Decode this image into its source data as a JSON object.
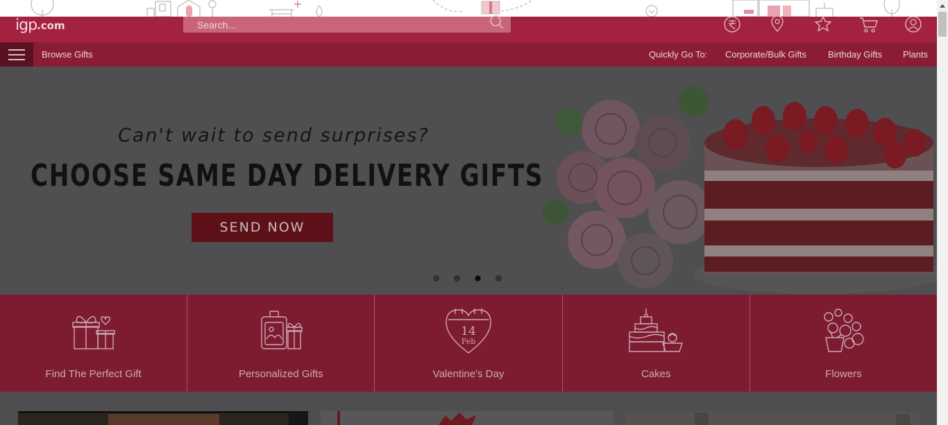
{
  "header": {
    "logo_main": "igp",
    "logo_suffix": ".com",
    "search_placeholder": "Search..."
  },
  "header_icons": [
    "currency-icon",
    "location-pin-icon",
    "star-icon",
    "cart-icon",
    "account-icon"
  ],
  "navbar": {
    "browse_label": "Browse Gifts",
    "quick_label": "Quickly Go To:",
    "links": [
      "Corporate/Bulk Gifts",
      "Birthday Gifts",
      "Plants"
    ]
  },
  "banner": {
    "tagline": "Can't wait to send surprises?",
    "headline": "CHOOSE SAME DAY DELIVERY GIFTS",
    "cta_label": "SEND NOW",
    "slide_count": 4,
    "active_slide": 3
  },
  "categories": [
    {
      "label": "Find The Perfect Gift",
      "icon": "gift-boxes-icon"
    },
    {
      "label": "Personalized Gifts",
      "icon": "personalized-gift-icon"
    },
    {
      "label": "Valentine's Day",
      "icon": "valentine-calendar-icon",
      "icon_day": "14",
      "icon_month": "Feb"
    },
    {
      "label": "Cakes",
      "icon": "cake-icon"
    },
    {
      "label": "Flowers",
      "icon": "flowers-icon"
    }
  ],
  "colors": {
    "header_bg": "#a3223f",
    "navbar_bg": "#8a1c33",
    "category_bg": "#7d1c31",
    "cta_bg": "#5e1019"
  }
}
